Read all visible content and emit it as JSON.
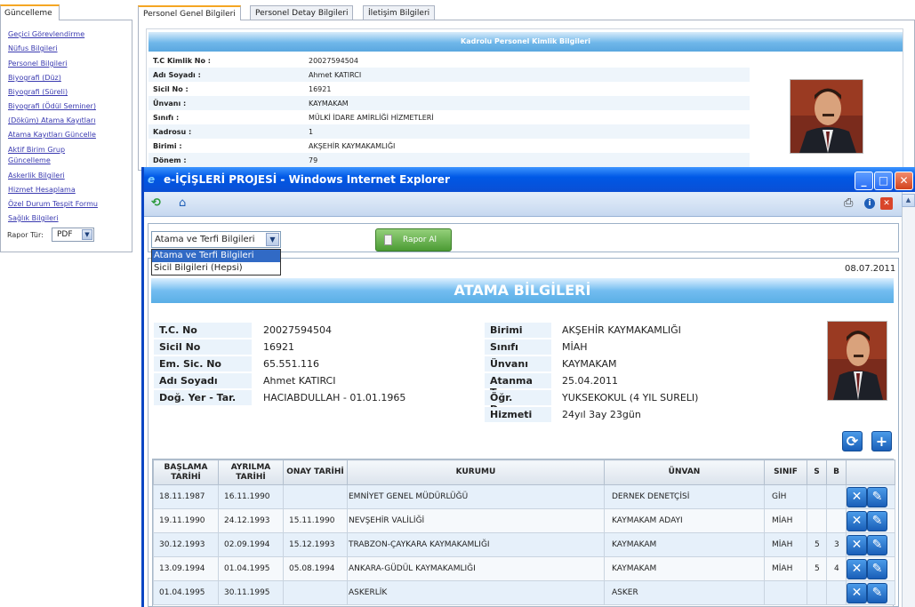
{
  "left_panel": {
    "tab_label": "Güncelleme",
    "links": [
      "Geçici Görevlendirme",
      "Nüfus Bilgileri",
      "Personel Bilgileri",
      "Biyografi (Düz)",
      "Biyografi (Süreli)",
      "Biyografi (Ödül Seminer)",
      "(Döküm) Atama Kayıtları",
      "Atama Kayıtları Güncelle",
      "Aktif Birim Grup",
      "Güncelleme",
      "Askerlik Bilgileri",
      "Hizmet Hesaplama",
      "Özel Durum Tespit Formu",
      "Sağlık Bilgileri"
    ],
    "rapor_label": "Rapor Tür:",
    "rapor_value": "PDF"
  },
  "bg_tabs": [
    "Personel Genel Bilgileri",
    "Personel Detay Bilgileri",
    "İletişim Bilgileri"
  ],
  "bg_header": "Kadrolu Personel Kimlik Bilgileri",
  "bg_rows": [
    {
      "k": "T.C Kimlik No :",
      "v": "20027594504"
    },
    {
      "k": "Adı Soyadı :",
      "v": "Ahmet KATIRCI"
    },
    {
      "k": "Sicil No :",
      "v": "16921"
    },
    {
      "k": "Ünvanı :",
      "v": "KAYMAKAM"
    },
    {
      "k": "Sınıfı :",
      "v": "MÜLKİ İDARE AMİRLİĞİ HİZMETLERİ"
    },
    {
      "k": "Kadrosu :",
      "v": "1"
    },
    {
      "k": "Birimi :",
      "v": "AKŞEHİR KAYMAKAMLIĞI"
    },
    {
      "k": "Dönem :",
      "v": "79"
    }
  ],
  "window": {
    "title": "e-İÇİŞLERİ PROJESİ - Windows Internet Explorer",
    "min": "_",
    "max": "□",
    "close": "✕"
  },
  "toolbar": {
    "refresh": "⟲",
    "home": "⌂",
    "print": "⎙",
    "info": "i",
    "close": "✕"
  },
  "report_select": {
    "value": "Atama ve Terfi Bilgileri",
    "options": [
      "Atama ve Terfi Bilgileri",
      "Sicil Bilgileri (Hepsi)"
    ]
  },
  "rapor_button": "Rapor Al",
  "report": {
    "date": "08.07.2011",
    "title": "ATAMA BİLGİLERİ",
    "left_info": [
      {
        "k": "T.C. No",
        "v": "20027594504"
      },
      {
        "k": "Sicil No",
        "v": "16921"
      },
      {
        "k": "Em. Sic. No",
        "v": "65.551.116"
      },
      {
        "k": "Adı Soyadı",
        "v": "Ahmet KATIRCI"
      },
      {
        "k": "Doğ. Yer - Tar.",
        "v": "HACIABDULLAH - 01.01.1965"
      }
    ],
    "right_info": [
      {
        "k": "Birimi",
        "v": "AKŞEHİR KAYMAKAMLIĞI"
      },
      {
        "k": "Sınıfı",
        "v": "MİAH"
      },
      {
        "k": "Ünvanı",
        "v": "KAYMAKAM"
      },
      {
        "k": "Atanma Tar.",
        "v": "25.04.2011"
      },
      {
        "k": "Öğr. Durum",
        "v": "YUKSEKOKUL (4 YIL SURELI)"
      },
      {
        "k": "Hizmeti",
        "v": "24yıl 3ay 23gün"
      }
    ],
    "columns": [
      "BAŞLAMA TARİHİ",
      "AYRILMA TARİHİ",
      "ONAY TARİHİ",
      "KURUMU",
      "ÜNVAN",
      "SINIF",
      "S",
      "B",
      ""
    ],
    "rows": [
      [
        "18.11.1987",
        "16.11.1990",
        "",
        "EMNİYET GENEL MÜDÜRLÜĞÜ",
        "DERNEK DENETÇİSİ",
        "GİH",
        "",
        ""
      ],
      [
        "19.11.1990",
        "24.12.1993",
        "15.11.1990",
        "NEVŞEHİR VALİLİĞİ",
        "KAYMAKAM ADAYI",
        "MİAH",
        "",
        ""
      ],
      [
        "30.12.1993",
        "02.09.1994",
        "15.12.1993",
        "TRABZON-ÇAYKARA KAYMAKAMLIĞI",
        "KAYMAKAM",
        "MİAH",
        "5",
        "3"
      ],
      [
        "13.09.1994",
        "01.04.1995",
        "05.08.1994",
        "ANKARA-GÜDÜL KAYMAKAMLIĞI",
        "KAYMAKAM",
        "MİAH",
        "5",
        "4"
      ],
      [
        "01.04.1995",
        "30.11.1995",
        "",
        "ASKERLİK",
        "ASKER",
        "",
        "",
        ""
      ]
    ]
  },
  "colors": {
    "accent": "#5aa7df",
    "title_bar": "#0a4fd4",
    "row_alt": "#e6f0fa"
  }
}
